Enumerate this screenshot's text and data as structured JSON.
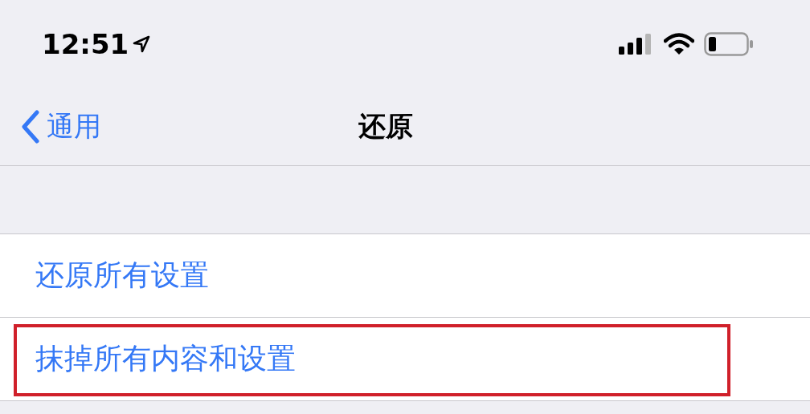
{
  "status_bar": {
    "time": "12:51"
  },
  "nav": {
    "back": "通用",
    "title": "还原"
  },
  "items": [
    {
      "label": "还原所有设置",
      "highlighted": false
    },
    {
      "label": "抹掉所有内容和设置",
      "highlighted": true
    }
  ]
}
